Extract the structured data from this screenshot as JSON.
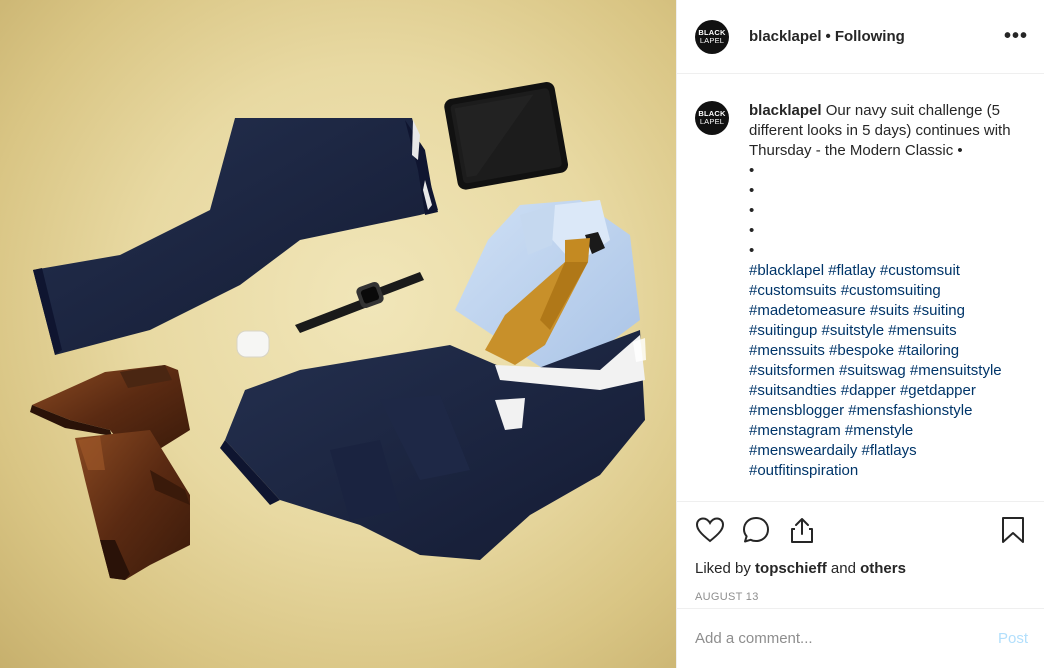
{
  "header": {
    "avatar_line1": "BLACK",
    "avatar_line2": "LAPEL",
    "username": "blacklapel",
    "separator": "•",
    "follow_status": "Following",
    "more_icon": "more-horizontal-icon",
    "more_label": "•••"
  },
  "caption": {
    "avatar_line1": "BLACK",
    "avatar_line2": "LAPEL",
    "username": "blacklapel",
    "text": "Our navy suit challenge (5 different looks in 5 days) continues with Thursday - the Modern Classic •",
    "bullets": [
      "•",
      "•",
      "•",
      "•",
      "•"
    ],
    "hashtags": "#blacklapel #flatlay #customsuit #customsuits #customsuiting #madetomeasure #suits #suiting #suitingup #suitstyle #mensuits #menssuits #bespoke #tailoring #suitsformen #suitswag #mensuitstyle #suitsandties #dapper #getdapper #mensblogger #mensfashionstyle #menstagram #menstyle #mensweardaily #flatlays #outfitinspiration"
  },
  "actions": {
    "like_icon": "heart-icon",
    "comment_icon": "comment-bubble-icon",
    "share_icon": "share-icon",
    "save_icon": "bookmark-icon"
  },
  "likes": {
    "prefix": "Liked by",
    "user": "topschieff",
    "middle": "and",
    "others": "others"
  },
  "date": "AUGUST 13",
  "comment": {
    "placeholder": "Add a comment...",
    "post_label": "Post"
  },
  "colors": {
    "link_blue": "#003569",
    "post_disabled": "#b2dffc",
    "background_tan": "#e8d9a2",
    "navy_suit": "#1b2544"
  },
  "media": {
    "description_icons": [
      "navy-trousers",
      "tablet",
      "smartwatch",
      "earbuds-case",
      "brown-boots",
      "light-blue-shirt",
      "mustard-tie",
      "navy-jacket"
    ]
  }
}
